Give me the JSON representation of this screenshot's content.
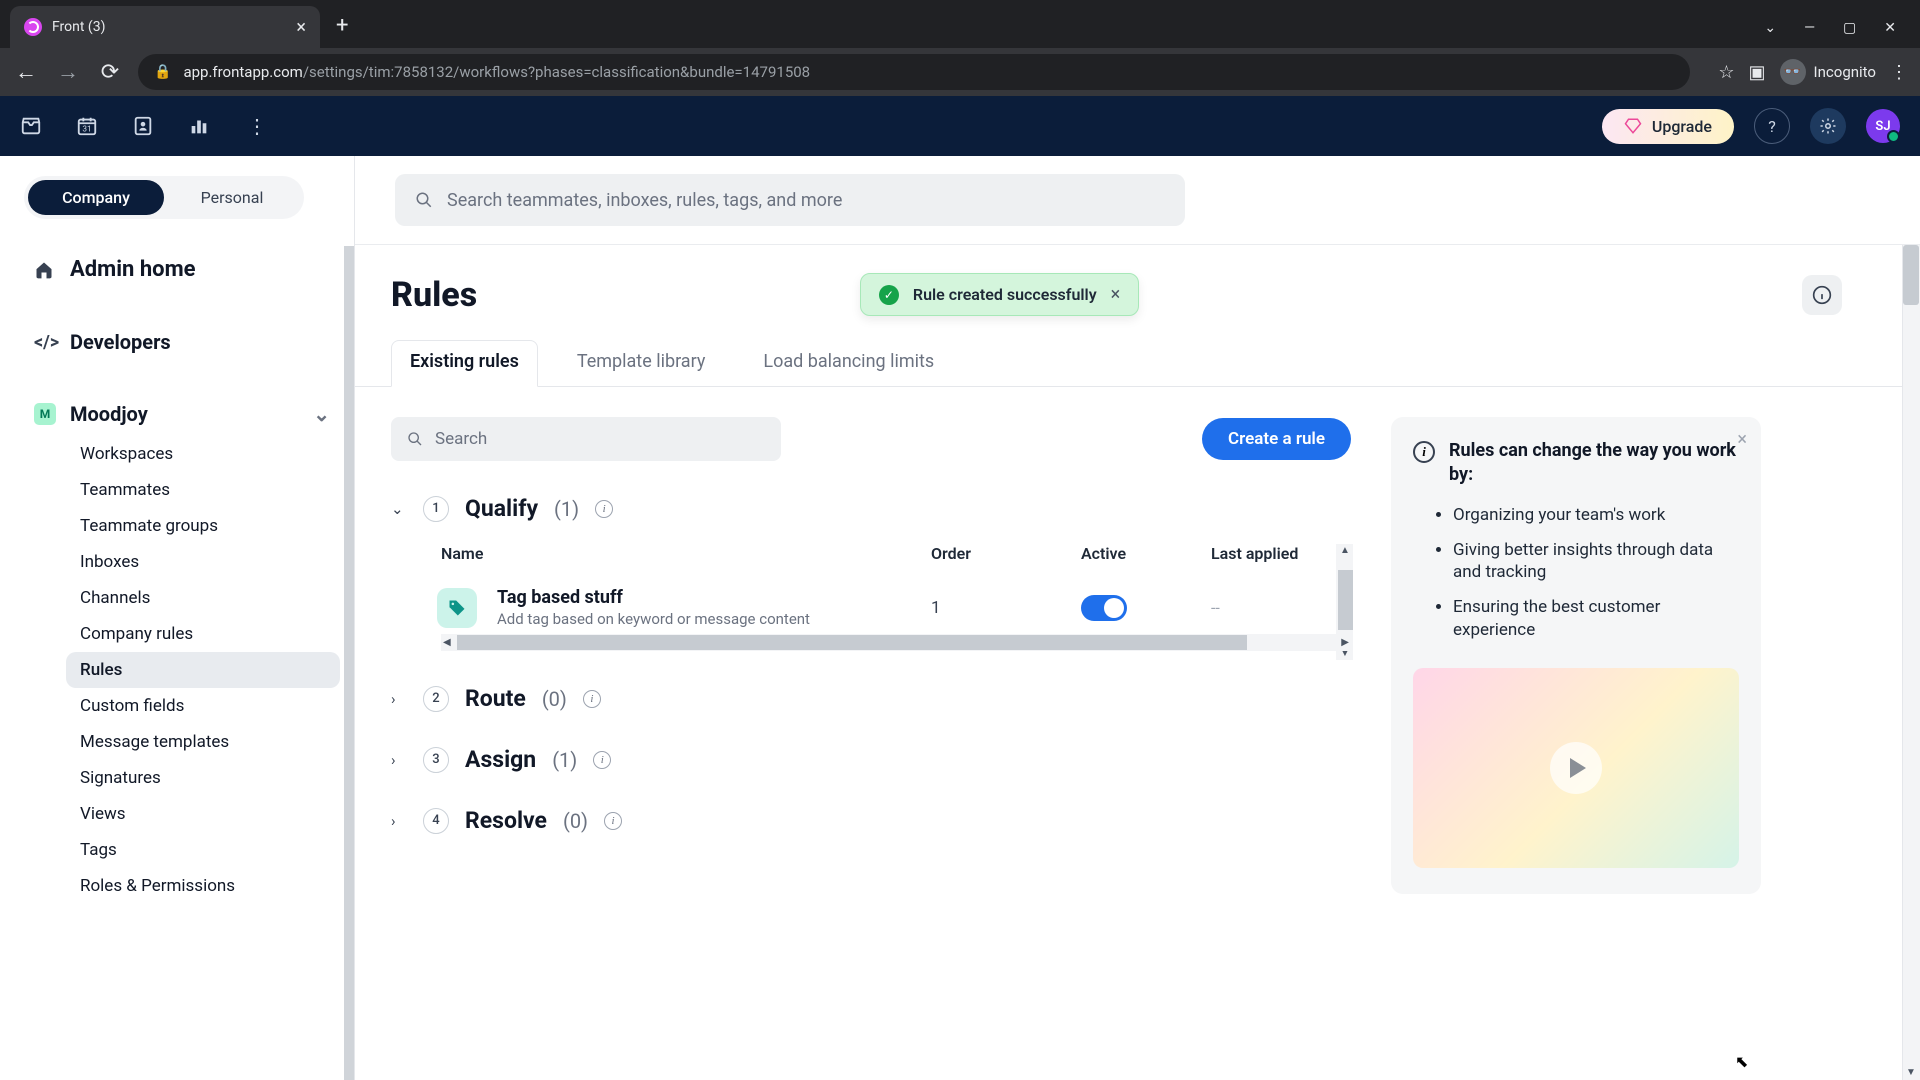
{
  "browser": {
    "tab_title": "Front (3)",
    "url_host": "app.frontapp.com",
    "url_path": "/settings/tim:7858132/workflows?phases=classification&bundle=14791508",
    "incognito_label": "Incognito"
  },
  "header": {
    "upgrade_label": "Upgrade",
    "avatar_initials": "SJ"
  },
  "sidebar": {
    "scope": {
      "company": "Company",
      "personal": "Personal"
    },
    "admin_home": "Admin home",
    "developers": "Developers",
    "workspace": {
      "badge": "M",
      "name": "Moodjoy"
    },
    "items": [
      "Workspaces",
      "Teammates",
      "Teammate groups",
      "Inboxes",
      "Channels",
      "Company rules",
      "Rules",
      "Custom fields",
      "Message templates",
      "Signatures",
      "Views",
      "Tags",
      "Roles & Permissions"
    ],
    "active_index": 6
  },
  "search": {
    "placeholder": "Search teammates, inboxes, rules, tags, and more"
  },
  "page": {
    "title": "Rules",
    "toast": "Rule created successfully",
    "tabs": [
      "Existing rules",
      "Template library",
      "Load balancing limits"
    ],
    "active_tab": 0
  },
  "controls": {
    "search_placeholder": "Search",
    "create_label": "Create a rule"
  },
  "phases": [
    {
      "num": "1",
      "name": "Qualify",
      "count": "(1)",
      "expanded": true,
      "columns": {
        "name": "Name",
        "order": "Order",
        "active": "Active",
        "last": "Last applied"
      },
      "rules": [
        {
          "name": "Tag based stuff",
          "desc": "Add tag based on keyword or message content",
          "order": "1",
          "active": true,
          "last": "--"
        }
      ]
    },
    {
      "num": "2",
      "name": "Route",
      "count": "(0)",
      "expanded": false
    },
    {
      "num": "3",
      "name": "Assign",
      "count": "(1)",
      "expanded": false
    },
    {
      "num": "4",
      "name": "Resolve",
      "count": "(0)",
      "expanded": false
    }
  ],
  "info_panel": {
    "title": "Rules can change the way you work by:",
    "bullets": [
      "Organizing your team's work",
      "Giving better insights through data and tracking",
      "Ensuring the best customer experience"
    ]
  }
}
